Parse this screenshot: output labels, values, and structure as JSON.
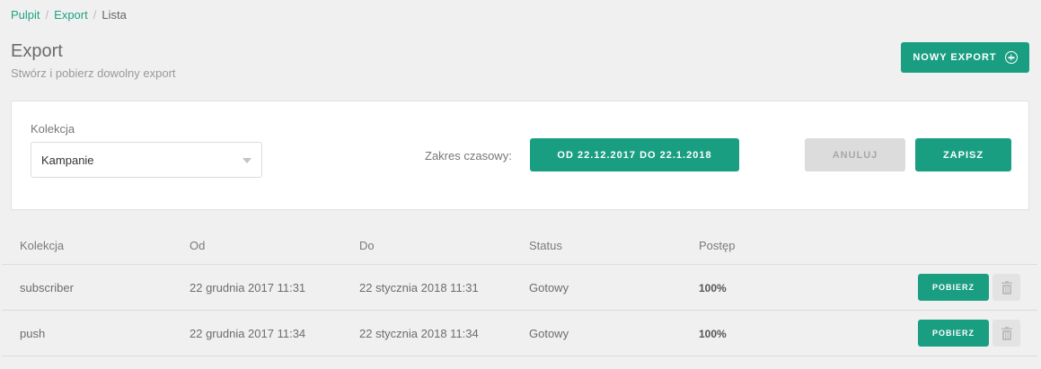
{
  "breadcrumb": {
    "items": [
      "Pulpit",
      "Export"
    ],
    "current": "Lista",
    "separator": "/"
  },
  "header": {
    "title": "Export",
    "subtitle": "Stwórz i pobierz dowolny export",
    "new_button": "NOWY EXPORT",
    "new_button_icon": "plus-circle-icon"
  },
  "form": {
    "collection_label": "Kolekcja",
    "collection_value": "Kampanie",
    "range_label": "Zakres czasowy:",
    "range_button": "OD 22.12.2017 DO 22.1.2018",
    "cancel_label": "ANULUJ",
    "save_label": "ZAPISZ"
  },
  "table": {
    "columns": [
      "Kolekcja",
      "Od",
      "Do",
      "Status",
      "Postęp"
    ],
    "rows": [
      {
        "collection": "subscriber",
        "from": "22 grudnia 2017 11:31",
        "to": "22 stycznia 2018 11:31",
        "status": "Gotowy",
        "progress": "100%",
        "download_label": "POBIERZ"
      },
      {
        "collection": "push",
        "from": "22 grudnia 2017 11:34",
        "to": "22 stycznia 2018 11:34",
        "status": "Gotowy",
        "progress": "100%",
        "download_label": "POBIERZ"
      }
    ]
  },
  "colors": {
    "accent": "#1a9e82",
    "link": "#1fa283",
    "background": "#f0f0f1"
  }
}
